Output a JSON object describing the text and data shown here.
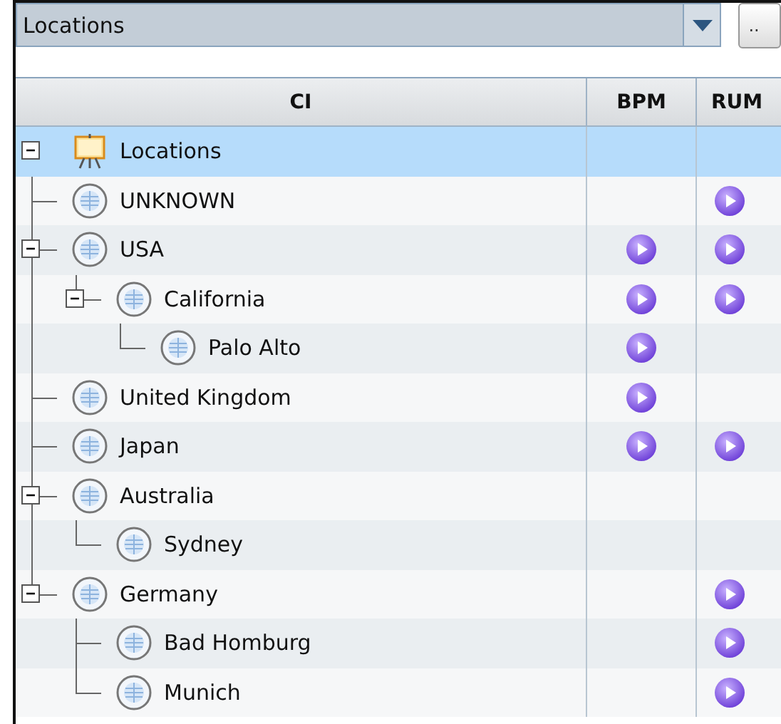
{
  "selector": {
    "value": "Locations",
    "browse_button": ".."
  },
  "table": {
    "columns": [
      "CI",
      "BPM",
      "RUM"
    ],
    "tree": [
      {
        "name": "Locations",
        "kind": "root",
        "selected": true,
        "expanded": true,
        "bpm": false,
        "rum": false,
        "children": [
          {
            "name": "UNKNOWN",
            "kind": "location",
            "selected": false,
            "bpm": false,
            "rum": true
          },
          {
            "name": "USA",
            "kind": "location",
            "selected": false,
            "expanded": true,
            "bpm": true,
            "rum": true,
            "children": [
              {
                "name": "California",
                "kind": "location",
                "selected": false,
                "expanded": true,
                "bpm": true,
                "rum": true,
                "children": [
                  {
                    "name": "Palo Alto",
                    "kind": "location",
                    "selected": false,
                    "bpm": true,
                    "rum": false
                  }
                ]
              }
            ]
          },
          {
            "name": "United Kingdom",
            "kind": "location",
            "selected": false,
            "bpm": true,
            "rum": false
          },
          {
            "name": "Japan",
            "kind": "location",
            "selected": false,
            "bpm": true,
            "rum": true
          },
          {
            "name": "Australia",
            "kind": "location",
            "selected": false,
            "expanded": true,
            "bpm": false,
            "rum": false,
            "children": [
              {
                "name": "Sydney",
                "kind": "location",
                "selected": false,
                "bpm": false,
                "rum": false
              }
            ]
          },
          {
            "name": "Germany",
            "kind": "location",
            "selected": false,
            "expanded": true,
            "bpm": false,
            "rum": true,
            "children": [
              {
                "name": "Bad Homburg",
                "kind": "location",
                "selected": false,
                "bpm": false,
                "rum": true
              },
              {
                "name": "Munich",
                "kind": "location",
                "selected": false,
                "bpm": false,
                "rum": true
              }
            ]
          }
        ]
      }
    ]
  }
}
